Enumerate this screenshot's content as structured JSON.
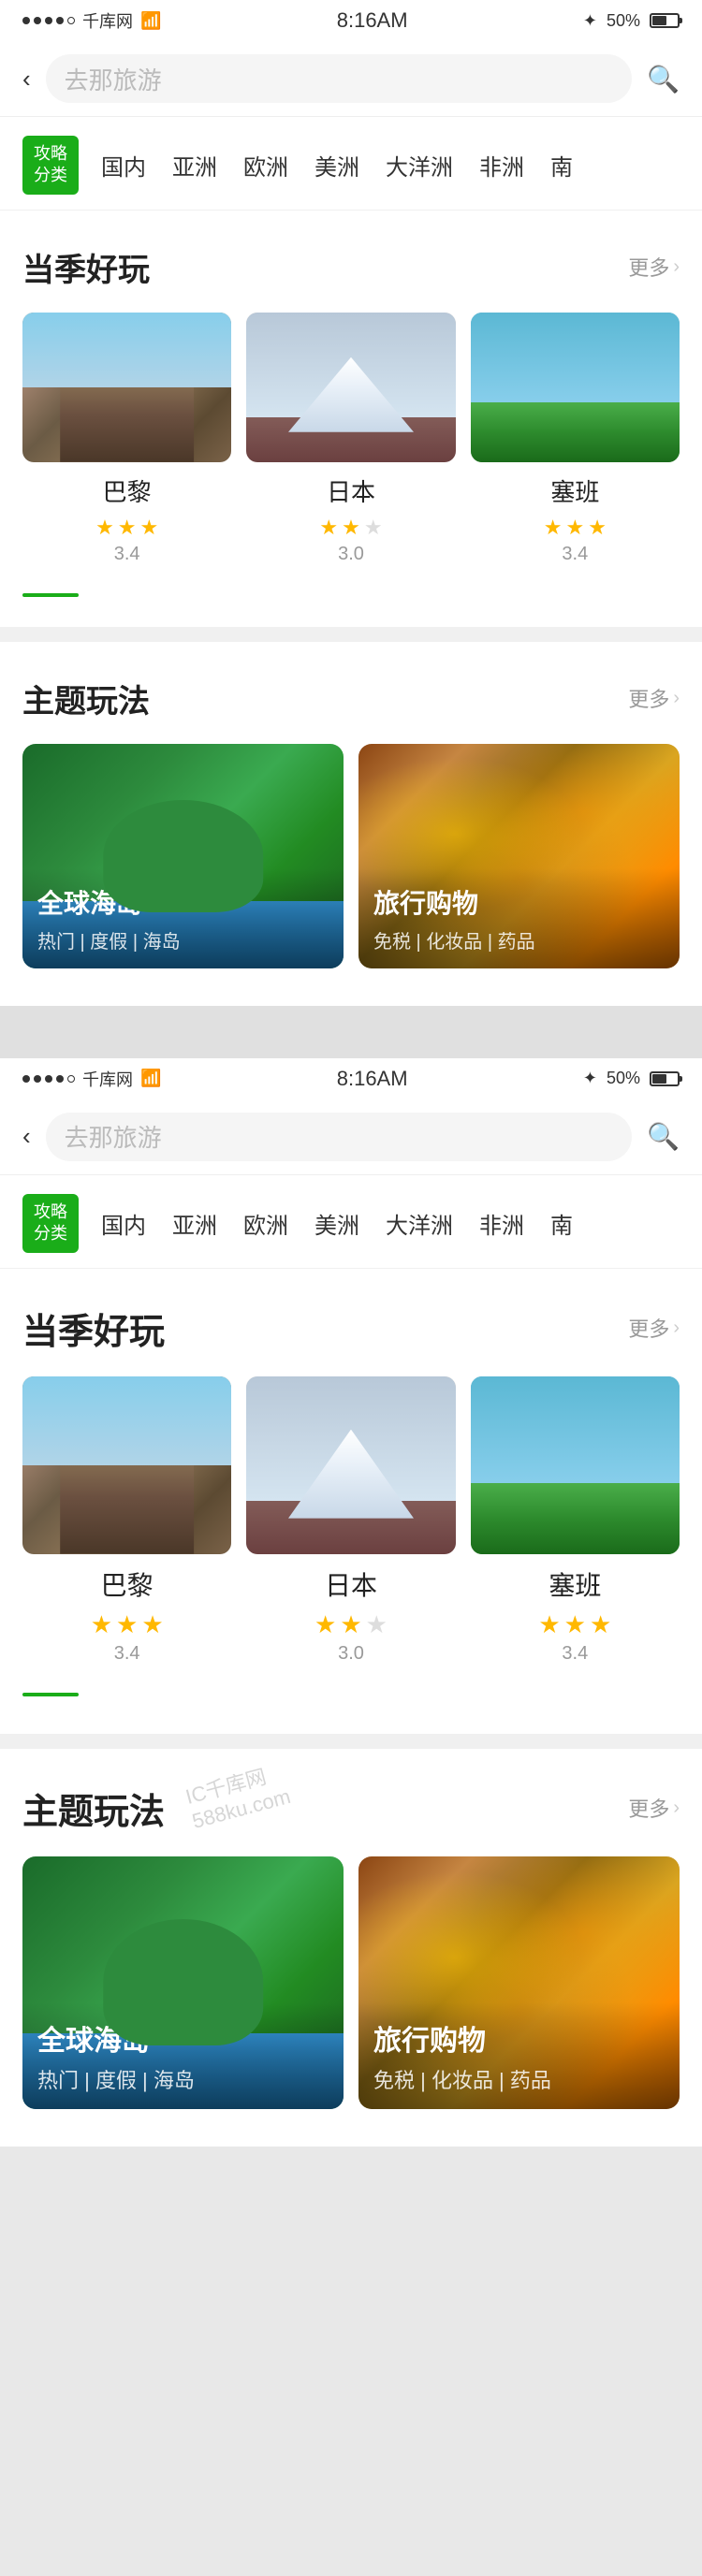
{
  "screen1": {
    "statusBar": {
      "carrier": "千库网",
      "time": "8:16AM",
      "battery": "50%"
    },
    "searchBar": {
      "placeholder": "去那旅游",
      "backLabel": "‹"
    },
    "categoryTag": {
      "line1": "攻略",
      "line2": "分类"
    },
    "categoryItems": [
      "国内",
      "亚洲",
      "欧洲",
      "美洲",
      "大洋洲",
      "非洲",
      "南"
    ],
    "sections": {
      "current": {
        "title": "当季好玩",
        "more": "更多"
      },
      "theme": {
        "title": "主题玩法",
        "more": "更多"
      }
    },
    "travelCards": [
      {
        "name": "巴黎",
        "rating": "3.4",
        "stars": 3
      },
      {
        "name": "日本",
        "rating": "3.0",
        "stars": 2
      },
      {
        "name": "塞班",
        "rating": "3.4",
        "stars": 3
      }
    ],
    "themeCards": [
      {
        "title": "全球海岛",
        "tags": "热门 | 度假 | 海岛"
      },
      {
        "title": "旅行购物",
        "tags": "免税 | 化妆品 | 药品"
      }
    ]
  },
  "watermark1": "IC千库网\n588ku.com",
  "watermark2": "IC千库网\n588ku.com"
}
